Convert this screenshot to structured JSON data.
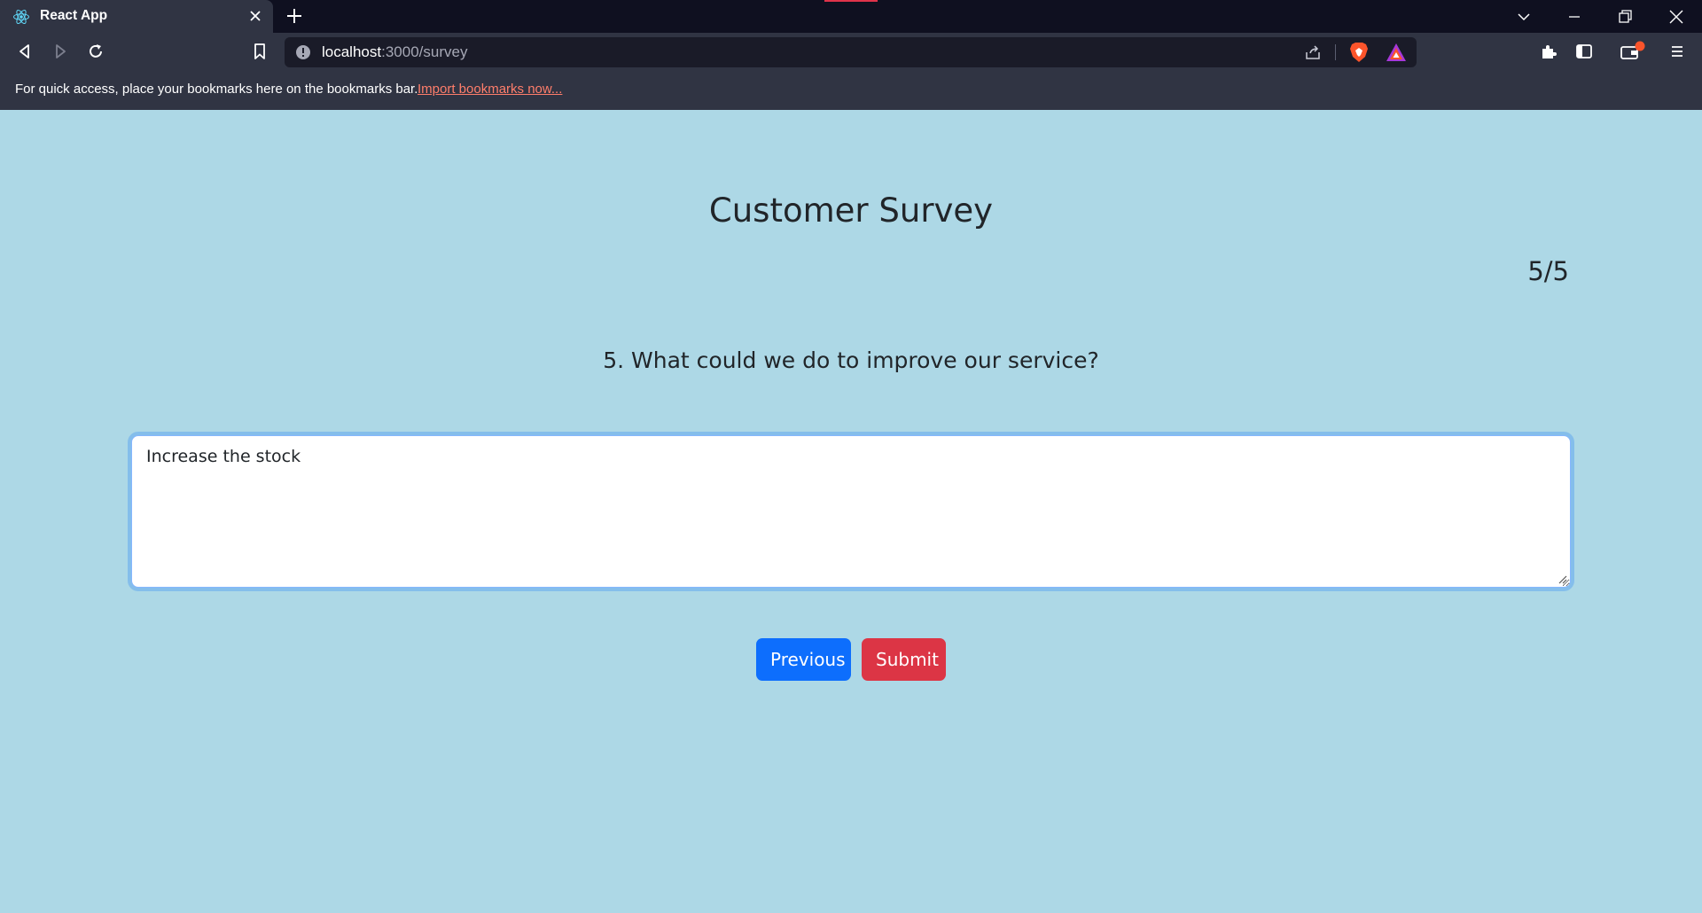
{
  "browser": {
    "tab": {
      "title": "React App",
      "favicon": "react-icon"
    },
    "toolbar": {
      "url_host": "localhost",
      "url_path": ":3000/survey"
    },
    "bookmarks_bar": {
      "message": "For quick access, place your bookmarks here on the bookmarks bar.",
      "import_link": "Import bookmarks now..."
    }
  },
  "survey": {
    "title": "Customer Survey",
    "progress": "5/5",
    "question": "5. What could we do to improve our service?",
    "answer": "Increase the stock",
    "buttons": {
      "previous": "Previous",
      "submit": "Submit"
    }
  },
  "colors": {
    "page_background": "#add8e6",
    "previous_button": "#0d6efd",
    "submit_button": "#dc3545",
    "link": "#ff7e6b"
  }
}
